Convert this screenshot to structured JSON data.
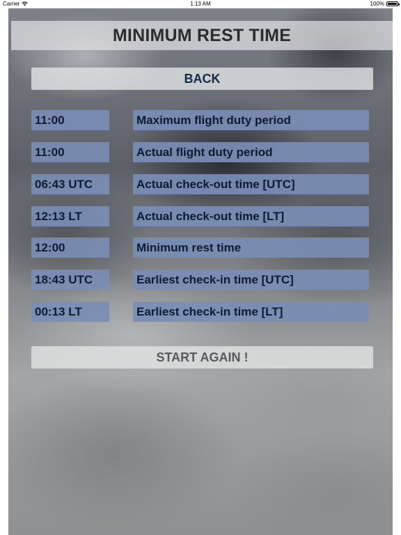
{
  "status_bar": {
    "carrier": "Carrier",
    "time": "1:13 AM",
    "battery": "100%"
  },
  "title": "MINIMUM REST TIME",
  "back_button": "BACK",
  "rows": [
    {
      "value": "11:00",
      "label": "Maximum flight duty period"
    },
    {
      "value": "11:00",
      "label": "Actual flight duty period"
    },
    {
      "value": "06:43 UTC",
      "label": "Actual check-out time [UTC]"
    },
    {
      "value": "12:13 LT",
      "label": "Actual check-out time [LT]"
    },
    {
      "value": "12:00",
      "label": "Minimum rest time"
    },
    {
      "value": "18:43 UTC",
      "label": "Earliest check-in time [UTC]"
    },
    {
      "value": "00:13 LT",
      "label": "Earliest check-in time [LT]"
    }
  ],
  "start_again_button": "START AGAIN !",
  "icons": {
    "wifi": "wifi-icon",
    "battery": "battery-icon"
  },
  "colors": {
    "field_background": "#798db4",
    "field_text": "#0c1a34",
    "back_text": "#152a48",
    "start_text": "#555a60"
  }
}
